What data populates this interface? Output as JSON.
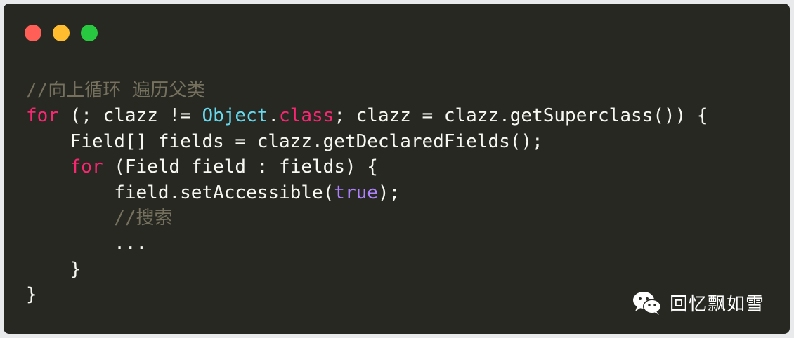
{
  "window": {
    "controls": [
      {
        "name": "close",
        "color": "#ff5f57"
      },
      {
        "name": "minimize",
        "color": "#febc2e"
      },
      {
        "name": "zoom",
        "color": "#28c840"
      }
    ]
  },
  "code": {
    "language": "java",
    "lines": [
      [
        {
          "t": "//向上循环 遍历父类",
          "k": "comment"
        }
      ],
      [
        {
          "t": "for",
          "k": "keyword"
        },
        {
          "t": " (; clazz != ",
          "k": "plain"
        },
        {
          "t": "Object",
          "k": "type"
        },
        {
          "t": ".",
          "k": "plain"
        },
        {
          "t": "class",
          "k": "keyword"
        },
        {
          "t": "; clazz = clazz.getSuperclass()) {",
          "k": "plain"
        }
      ],
      [
        {
          "t": "    Field[] fields = clazz.getDeclaredFields();",
          "k": "plain"
        }
      ],
      [
        {
          "t": "    ",
          "k": "plain"
        },
        {
          "t": "for",
          "k": "keyword"
        },
        {
          "t": " (Field field : fields) {",
          "k": "plain"
        }
      ],
      [
        {
          "t": "        field.setAccessible(",
          "k": "plain"
        },
        {
          "t": "true",
          "k": "const"
        },
        {
          "t": ");",
          "k": "plain"
        }
      ],
      [
        {
          "t": "        ",
          "k": "plain"
        },
        {
          "t": "//搜索",
          "k": "comment"
        }
      ],
      [
        {
          "t": "        ...",
          "k": "plain"
        }
      ],
      [
        {
          "t": "    }",
          "k": "plain"
        }
      ],
      [
        {
          "t": "}",
          "k": "plain"
        }
      ]
    ],
    "colors": {
      "background": "#272822",
      "comment": "#75715e",
      "keyword": "#f92672",
      "type": "#66d9ef",
      "const": "#ae81ff",
      "plain": "#f8f8f2"
    }
  },
  "watermark": {
    "icon": "wechat-icon",
    "text": "回忆飘如雪"
  }
}
